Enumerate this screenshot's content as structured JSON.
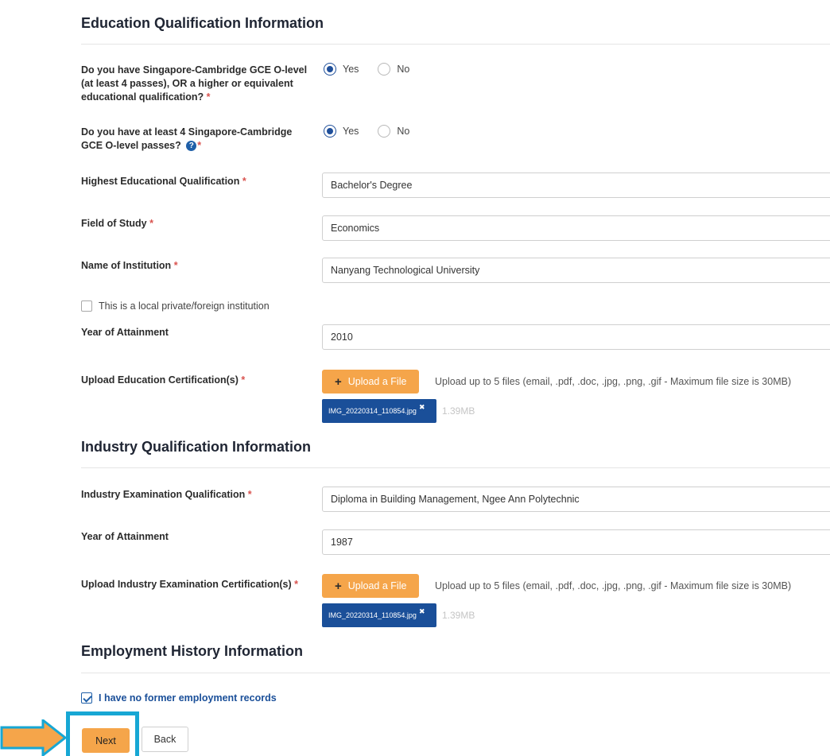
{
  "education": {
    "title": "Education Qualification Information",
    "q1": {
      "label": "Do you have Singapore-Cambridge GCE O-level (at least 4 passes), OR a higher or equivalent educational qualification?",
      "req": "*",
      "yes": "Yes",
      "no": "No",
      "selected": "Yes"
    },
    "q2": {
      "label": "Do you have at least 4 Singapore-Cambridge GCE O-level passes?",
      "req": "*",
      "help": "?",
      "yes": "Yes",
      "no": "No",
      "selected": "Yes"
    },
    "highest_qualification": {
      "label": "Highest Educational Qualification",
      "req": "*",
      "value": "Bachelor's Degree"
    },
    "field_of_study": {
      "label": "Field of Study",
      "req": "*",
      "value": "Economics"
    },
    "institution": {
      "label": "Name of Institution",
      "req": "*",
      "value": "Nanyang Technological University"
    },
    "local_private_checkbox": {
      "label": "This is a local private/foreign institution",
      "checked": false
    },
    "year_of_attainment": {
      "label": "Year of Attainment",
      "value": "2010"
    },
    "upload": {
      "label": "Upload Education Certification(s)",
      "req": "*",
      "button": "Upload a File",
      "hint": "Upload up to 5 files (email, .pdf, .doc, .jpg, .png, .gif - Maximum file size is 30MB)",
      "file_name": "IMG_20220314_110854.jpg",
      "file_remove": "✖",
      "file_size": "1.39MB"
    }
  },
  "industry": {
    "title": "Industry Qualification Information",
    "qualification": {
      "label": "Industry Examination Qualification",
      "req": "*",
      "value": "Diploma in Building Management, Ngee Ann Polytechnic"
    },
    "year_of_attainment": {
      "label": "Year of Attainment",
      "value": "1987"
    },
    "upload": {
      "label": "Upload Industry Examination Certification(s)",
      "req": "*",
      "button": "Upload a File",
      "hint": "Upload up to 5 files (email, .pdf, .doc, .jpg, .png, .gif - Maximum file size is 30MB)",
      "file_name": "IMG_20220314_110854.jpg",
      "file_remove": "✖",
      "file_size": "1.39MB"
    }
  },
  "employment": {
    "title": "Employment History Information",
    "no_records_checkbox": {
      "label": "I have no former employment records",
      "checked": true
    }
  },
  "actions": {
    "next": "Next",
    "back": "Back"
  },
  "colors": {
    "accent_orange": "#f5a54a",
    "primary_blue": "#1a4f99",
    "highlight_cyan": "#17a7d4",
    "required_red": "#d9534f"
  }
}
